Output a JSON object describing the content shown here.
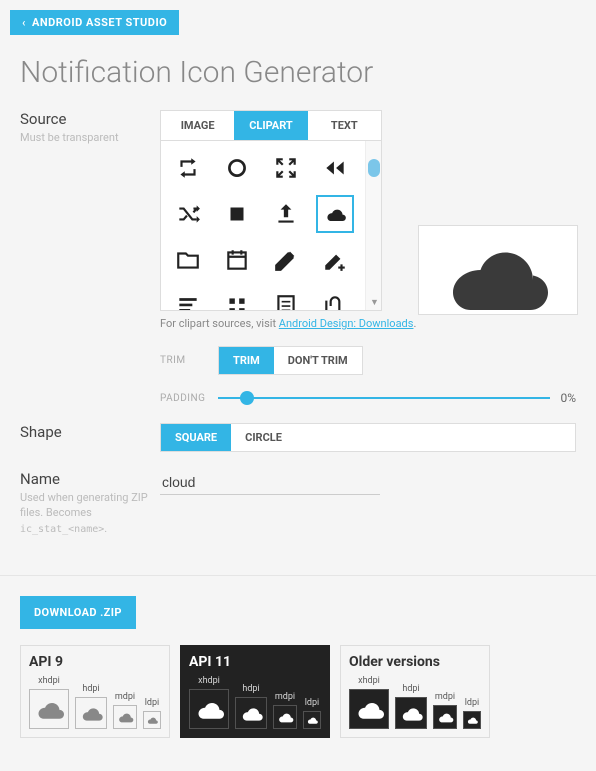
{
  "nav": {
    "label": "ANDROID ASSET STUDIO"
  },
  "title": "Notification Icon Generator",
  "source": {
    "label": "Source",
    "hint": "Must be transparent",
    "tabs": [
      "IMAGE",
      "CLIPART",
      "TEXT"
    ],
    "active_tab": "CLIPART",
    "clipart_help_prefix": "For clipart sources, visit ",
    "clipart_help_link": "Android Design: Downloads",
    "clipart_items": [
      "repeat-icon",
      "circle-icon",
      "collapse-icon",
      "rewind-icon",
      "shuffle-icon",
      "stop-icon",
      "upload-icon",
      "cloud-icon",
      "folder-icon",
      "calendar-icon",
      "edit-icon",
      "edit-add-icon",
      "list-icon",
      "grid-icon",
      "document-icon",
      "attachment-icon"
    ],
    "selected_clipart": "cloud-icon"
  },
  "trim": {
    "label": "TRIM",
    "options": [
      "TRIM",
      "DON'T TRIM"
    ],
    "active": "TRIM"
  },
  "padding": {
    "label": "PADDING",
    "value": "0%"
  },
  "shape": {
    "label": "Shape",
    "options": [
      "SQUARE",
      "CIRCLE"
    ],
    "active": "SQUARE"
  },
  "name": {
    "label": "Name",
    "hint_a": "Used when generating ZIP files. Becomes",
    "hint_b": "ic_stat_<name>",
    "hint_c": ".",
    "value": "cloud"
  },
  "download": {
    "label": "DOWNLOAD .ZIP"
  },
  "outputs": [
    {
      "title": "API 9",
      "theme": "light",
      "sizes": [
        "xhdpi",
        "hdpi",
        "mdpi",
        "ldpi"
      ]
    },
    {
      "title": "API 11",
      "theme": "dark",
      "sizes": [
        "xhdpi",
        "hdpi",
        "mdpi",
        "ldpi"
      ]
    },
    {
      "title": "Older versions",
      "theme": "older",
      "sizes": [
        "xhdpi",
        "hdpi",
        "mdpi",
        "ldpi"
      ]
    }
  ]
}
